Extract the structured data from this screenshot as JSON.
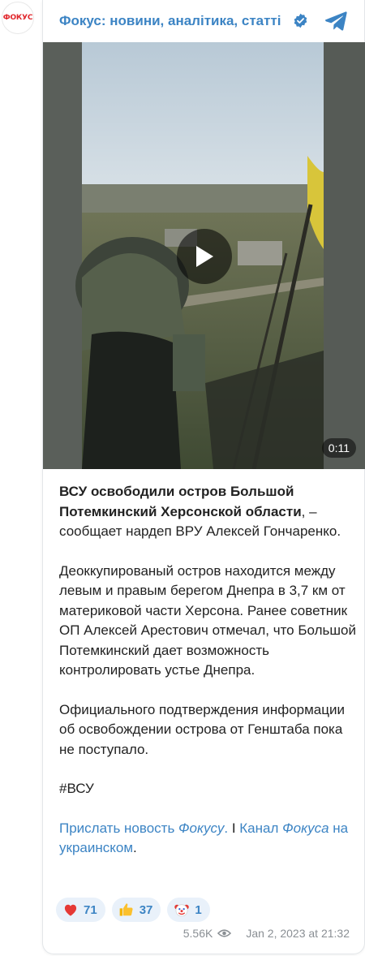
{
  "channel": {
    "avatar_text": "ФОКУС",
    "name": "Фокус: новини, аналітика, статті",
    "accent_color": "#3c84c4",
    "verified_icon": "verified-check-icon",
    "app_icon": "telegram-icon"
  },
  "video": {
    "duration": "0:11",
    "play_icon": "play-icon"
  },
  "post": {
    "p1_bold": "ВСУ освободили остров Большой Потемкинский Херсонской области",
    "p1_rest": ", – сообщает нардеп ВРУ Алексей Гончаренко.",
    "p2": "Деоккупированый остров находится между левым и правым берегом Днепра в 3,7 км от материковой части Херсона. Ранее советник ОП Алексей Арестович отмечал, что Большой Потемкинский дает возможность контролировать устье Днепра.",
    "p3": "Официального подтверждения информации об освобождении острова от Генштаба пока не поступало.",
    "hashtag": "#ВСУ",
    "link1_a": "Прислать новость ",
    "link1_b": "Фокусу",
    "link1_c": ".",
    "separator": " I ",
    "link2_a": "Канал ",
    "link2_b": "Фокуса",
    "link2_c": " на украинском",
    "link2_end": "."
  },
  "reactions": [
    {
      "icon": "heart-icon",
      "count": "71"
    },
    {
      "icon": "thumbs-up-icon",
      "count": "37"
    },
    {
      "icon": "clown-face-icon",
      "count": "1"
    }
  ],
  "meta": {
    "views": "5.56K",
    "views_icon": "eye-icon",
    "date": "Jan 2, 2023 at 21:32"
  }
}
